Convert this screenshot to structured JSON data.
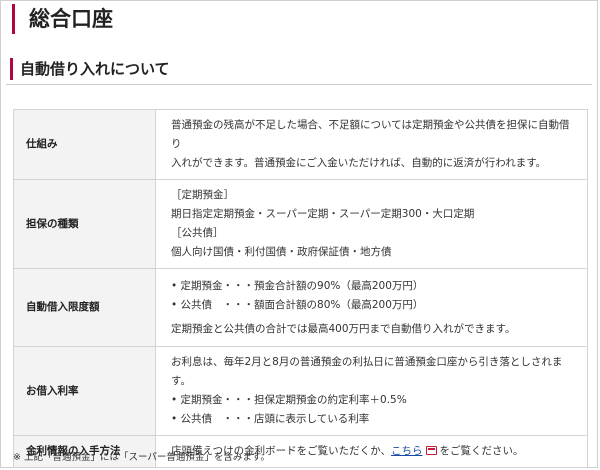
{
  "page": {
    "title": "総合口座"
  },
  "section": {
    "title": "自動借り入れについて"
  },
  "rows": [
    {
      "header": "仕組み",
      "lines": [
        "普通預金の残高が不足した場合、不足額については定期預金や公共債を担保に自動借り",
        "入れができます。普通預金にご入金いただければ、自動的に返済が行われます。"
      ]
    },
    {
      "header": "担保の種類",
      "lines": [
        "［定期預金］",
        "期日指定定期預金・スーパー定期・スーパー定期300・大口定期",
        "［公共債］",
        "個人向け国債・利付国債・政府保証債・地方債"
      ]
    },
    {
      "header": "自動借入限度額",
      "lines": [
        "• 定期預金・・・預金合計額の90%（最高200万円）",
        "• 公共債　・・・額面合計額の80%（最高200万円）",
        "定期預金と公共債の合計では最高400万円まで自動借り入れができます。"
      ]
    },
    {
      "header": "お借入利率",
      "lines": [
        "お利息は、毎年2月と8月の普通預金の利払日に普通預金口座から引き落としされます。",
        "• 定期預金・・・担保定期預金の約定利率＋0.5%",
        "• 公共債　・・・店頭に表示している利率"
      ]
    },
    {
      "header": "金利情報の入手方法",
      "before": "店頭備えつけの金利ボードをご覧いただくか、",
      "link": "こちら",
      "after": "をご覧ください。"
    }
  ],
  "note": "※ 上記「普通預金」には「スーパー普通預金」を含みます。"
}
